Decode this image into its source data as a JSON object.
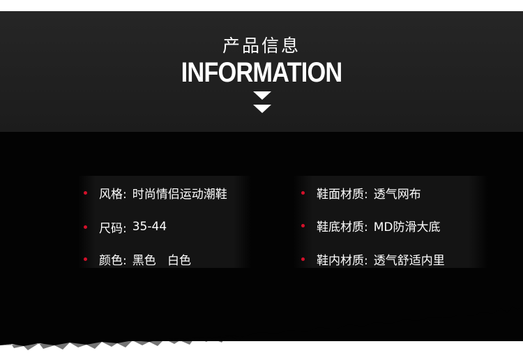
{
  "header": {
    "title_cn": "产品信息",
    "title_en": "INFORMATION",
    "icon": "double-chevron-down-icon"
  },
  "specs_left": [
    {
      "label": "风格:",
      "value": "时尚情侣运动潮鞋"
    },
    {
      "label": "尺码:",
      "value": "35-44"
    },
    {
      "label": "颜色:",
      "value": "黑色   白色"
    }
  ],
  "specs_right": [
    {
      "label": "鞋面材质:",
      "value": "透气网布"
    },
    {
      "label": "鞋底材质:",
      "value": "MD防滑大底"
    },
    {
      "label": "鞋内材质:",
      "value": "透气舒适内里"
    }
  ],
  "colors": {
    "bullet": "#d4102a",
    "header_bg": "#222222",
    "body_bg": "#030303",
    "text": "#ffffff"
  }
}
